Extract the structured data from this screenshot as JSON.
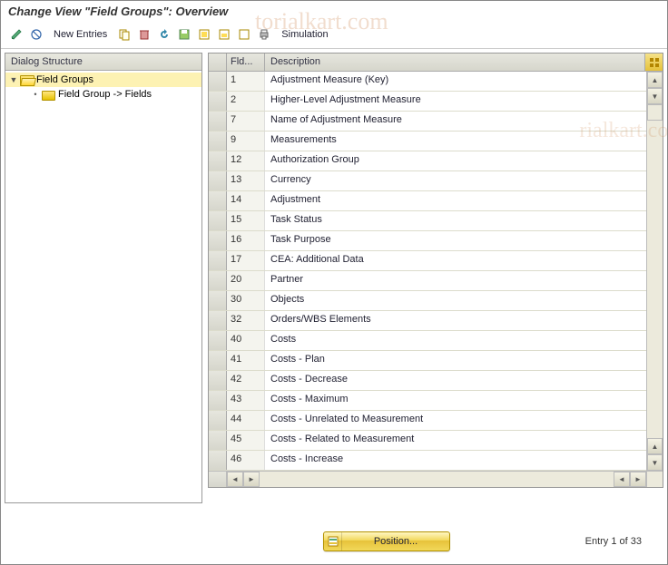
{
  "title": "Change View \"Field Groups\": Overview",
  "toolbar": {
    "new_entries": "New Entries",
    "simulation": "Simulation"
  },
  "tree": {
    "header": "Dialog Structure",
    "root": "Field Groups",
    "child": "Field Group -> Fields"
  },
  "grid": {
    "col_fld": "Fld...",
    "col_desc": "Description",
    "rows": [
      {
        "fld": "1",
        "desc": "Adjustment Measure (Key)"
      },
      {
        "fld": "2",
        "desc": "Higher-Level Adjustment Measure"
      },
      {
        "fld": "7",
        "desc": "Name of Adjustment Measure"
      },
      {
        "fld": "9",
        "desc": "Measurements"
      },
      {
        "fld": "12",
        "desc": "Authorization Group"
      },
      {
        "fld": "13",
        "desc": "Currency"
      },
      {
        "fld": "14",
        "desc": "Adjustment"
      },
      {
        "fld": "15",
        "desc": "Task Status"
      },
      {
        "fld": "16",
        "desc": "Task Purpose"
      },
      {
        "fld": "17",
        "desc": "CEA: Additional Data"
      },
      {
        "fld": "20",
        "desc": "Partner"
      },
      {
        "fld": "30",
        "desc": "Objects"
      },
      {
        "fld": "32",
        "desc": "Orders/WBS Elements"
      },
      {
        "fld": "40",
        "desc": "Costs"
      },
      {
        "fld": "41",
        "desc": "Costs - Plan"
      },
      {
        "fld": "42",
        "desc": "Costs - Decrease"
      },
      {
        "fld": "43",
        "desc": "Costs - Maximum"
      },
      {
        "fld": "44",
        "desc": "Costs - Unrelated to Measurement"
      },
      {
        "fld": "45",
        "desc": "Costs - Related to Measurement"
      },
      {
        "fld": "46",
        "desc": "Costs - Increase"
      }
    ]
  },
  "footer": {
    "position_label": "Position...",
    "entry_status": "Entry 1 of 33"
  }
}
